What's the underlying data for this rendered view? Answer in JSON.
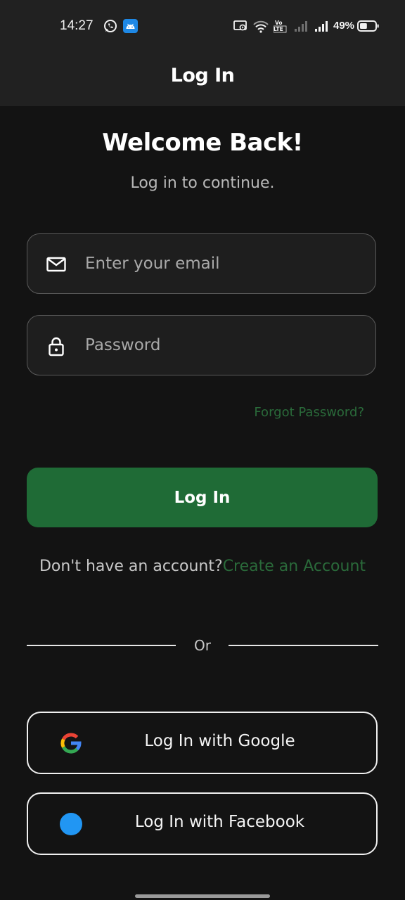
{
  "status_bar": {
    "time": "14:27",
    "battery_percent": "49%",
    "battery_level": 0.49,
    "icons": [
      "whatsapp-icon",
      "android-app-icon",
      "cast-screen-icon",
      "wifi-icon",
      "volte-icon",
      "signal-icon",
      "signal-icon",
      "battery-icon"
    ],
    "volte_label": "Vo LTE"
  },
  "app_bar": {
    "title": "Log In"
  },
  "welcome": {
    "title": "Welcome Back!",
    "subtitle": "Log in to continue."
  },
  "form": {
    "email": {
      "placeholder": "Enter your email",
      "value": "",
      "icon": "mail-icon"
    },
    "password": {
      "placeholder": "Password",
      "value": "",
      "icon": "lock-icon"
    },
    "forgot_label": "Forgot Password?",
    "login_label": "Log In"
  },
  "signup": {
    "prompt": "Don't have an account?",
    "link_label": "Create an Account"
  },
  "divider": {
    "label": "Or"
  },
  "social": {
    "google_label": "Log In with Google",
    "facebook_label": "Log In with Facebook"
  },
  "colors": {
    "background": "#131313",
    "bar": "#212121",
    "accent_green": "#1f6b36",
    "link_green": "#2a6a3a",
    "facebook_blue": "#2196f3"
  }
}
